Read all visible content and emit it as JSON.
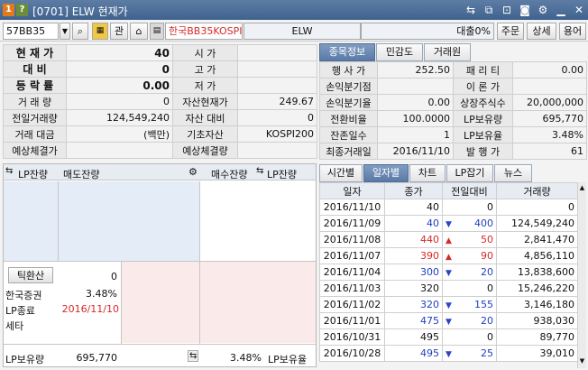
{
  "titlebar": {
    "badge1": "1",
    "badge2": "?",
    "title": "[0701] ELW 현재가"
  },
  "toolbar": {
    "code": "57BB35",
    "btn_gwan": "관",
    "name": "한국BB35KOSPI",
    "type": "ELW",
    "loan": "대출0%",
    "order": "주문",
    "detail": "상세",
    "term": "용어"
  },
  "quote": {
    "rows": [
      {
        "label": "현 재 가",
        "value": "40",
        "label2": "시 가",
        "value2": ""
      },
      {
        "label": "대 비",
        "value": "0",
        "label2": "고 가",
        "value2": ""
      },
      {
        "label": "등 락 률",
        "value": "0.00",
        "label2": "저 가",
        "value2": ""
      },
      {
        "label": "거 래 량",
        "value": "0",
        "label2": "자산현재가",
        "value2": "249.67"
      },
      {
        "label": "전일거래량",
        "value": "124,549,240",
        "label2": "자산 대비",
        "value2": "0"
      },
      {
        "label": "거래 대금",
        "value": "(백만)",
        "label2": "기초자산",
        "value2": "KOSPI200"
      },
      {
        "label": "예상체결가",
        "value": "",
        "label2": "예상체결량",
        "value2": ""
      }
    ]
  },
  "infotabs": [
    "종목정보",
    "민감도",
    "거래원"
  ],
  "info": {
    "rows": [
      {
        "l1": "행 사 가",
        "v1": "252.50",
        "l2": "패 리 티",
        "v2": "0.00"
      },
      {
        "l1": "손익분기점",
        "v1": "",
        "l2": "이 론 가",
        "v2": ""
      },
      {
        "l1": "손익분기율",
        "v1": "0.00",
        "l2": "상장주식수",
        "v2": "20,000,000"
      },
      {
        "l1": "전환비율",
        "v1": "100.0000",
        "l2": "LP보유량",
        "v2": "695,770"
      },
      {
        "l1": "잔존일수",
        "v1": "1",
        "l2": "LP보유율",
        "v2": "3.48%"
      },
      {
        "l1": "최종거래일",
        "v1": "2016/11/10",
        "l2": "발 행 가",
        "v2": "61"
      }
    ]
  },
  "orderbook": {
    "h_lp1": "LP잔량",
    "h_sell": "매도잔량",
    "h_buy": "매수잔량",
    "h_lp2": "LP잔량",
    "tick_btn": "틱환산",
    "tick_val": "0",
    "issuer": "한국증권",
    "issuer_rate": "3.48%",
    "lp_end_label": "LP종료",
    "lp_end_date": "2016/11/10",
    "tax": "세타",
    "foot_lp_label": "LP보유량",
    "foot_lp_value": "695,770",
    "foot_rate": "3.48%",
    "foot_rate_label": "LP보유율"
  },
  "histtabs": [
    "시간별",
    "일자별",
    "차트",
    "LP잡기",
    "뉴스"
  ],
  "history": {
    "headers": [
      "일자",
      "종가",
      "전일대비",
      "거래량"
    ],
    "rows": [
      {
        "date": "2016/11/10",
        "close": "40",
        "dir": "",
        "chg": "0",
        "vol": "0",
        "color": ""
      },
      {
        "date": "2016/11/09",
        "close": "40",
        "dir": "down",
        "chg": "400",
        "vol": "124,549,240",
        "color": "blue"
      },
      {
        "date": "2016/11/08",
        "close": "440",
        "dir": "up",
        "chg": "50",
        "vol": "2,841,470",
        "color": "red"
      },
      {
        "date": "2016/11/07",
        "close": "390",
        "dir": "up",
        "chg": "90",
        "vol": "4,856,110",
        "color": "red"
      },
      {
        "date": "2016/11/04",
        "close": "300",
        "dir": "down",
        "chg": "20",
        "vol": "13,838,600",
        "color": "blue"
      },
      {
        "date": "2016/11/03",
        "close": "320",
        "dir": "",
        "chg": "0",
        "vol": "15,246,220",
        "color": ""
      },
      {
        "date": "2016/11/02",
        "close": "320",
        "dir": "down",
        "chg": "155",
        "vol": "3,146,180",
        "color": "blue"
      },
      {
        "date": "2016/11/01",
        "close": "475",
        "dir": "down",
        "chg": "20",
        "vol": "938,030",
        "color": "blue"
      },
      {
        "date": "2016/10/31",
        "close": "495",
        "dir": "",
        "chg": "0",
        "vol": "89,770",
        "color": ""
      },
      {
        "date": "2016/10/28",
        "close": "495",
        "dir": "down",
        "chg": "25",
        "vol": "39,010",
        "color": "blue"
      }
    ]
  },
  "colors": {
    "title_bar": "#4a6d99",
    "name_red": "#d42a2a",
    "up": "#d42a2a",
    "down": "#2a44c8",
    "ask_bg": "#e4ecf7",
    "bid_bg": "#fbeaea"
  }
}
